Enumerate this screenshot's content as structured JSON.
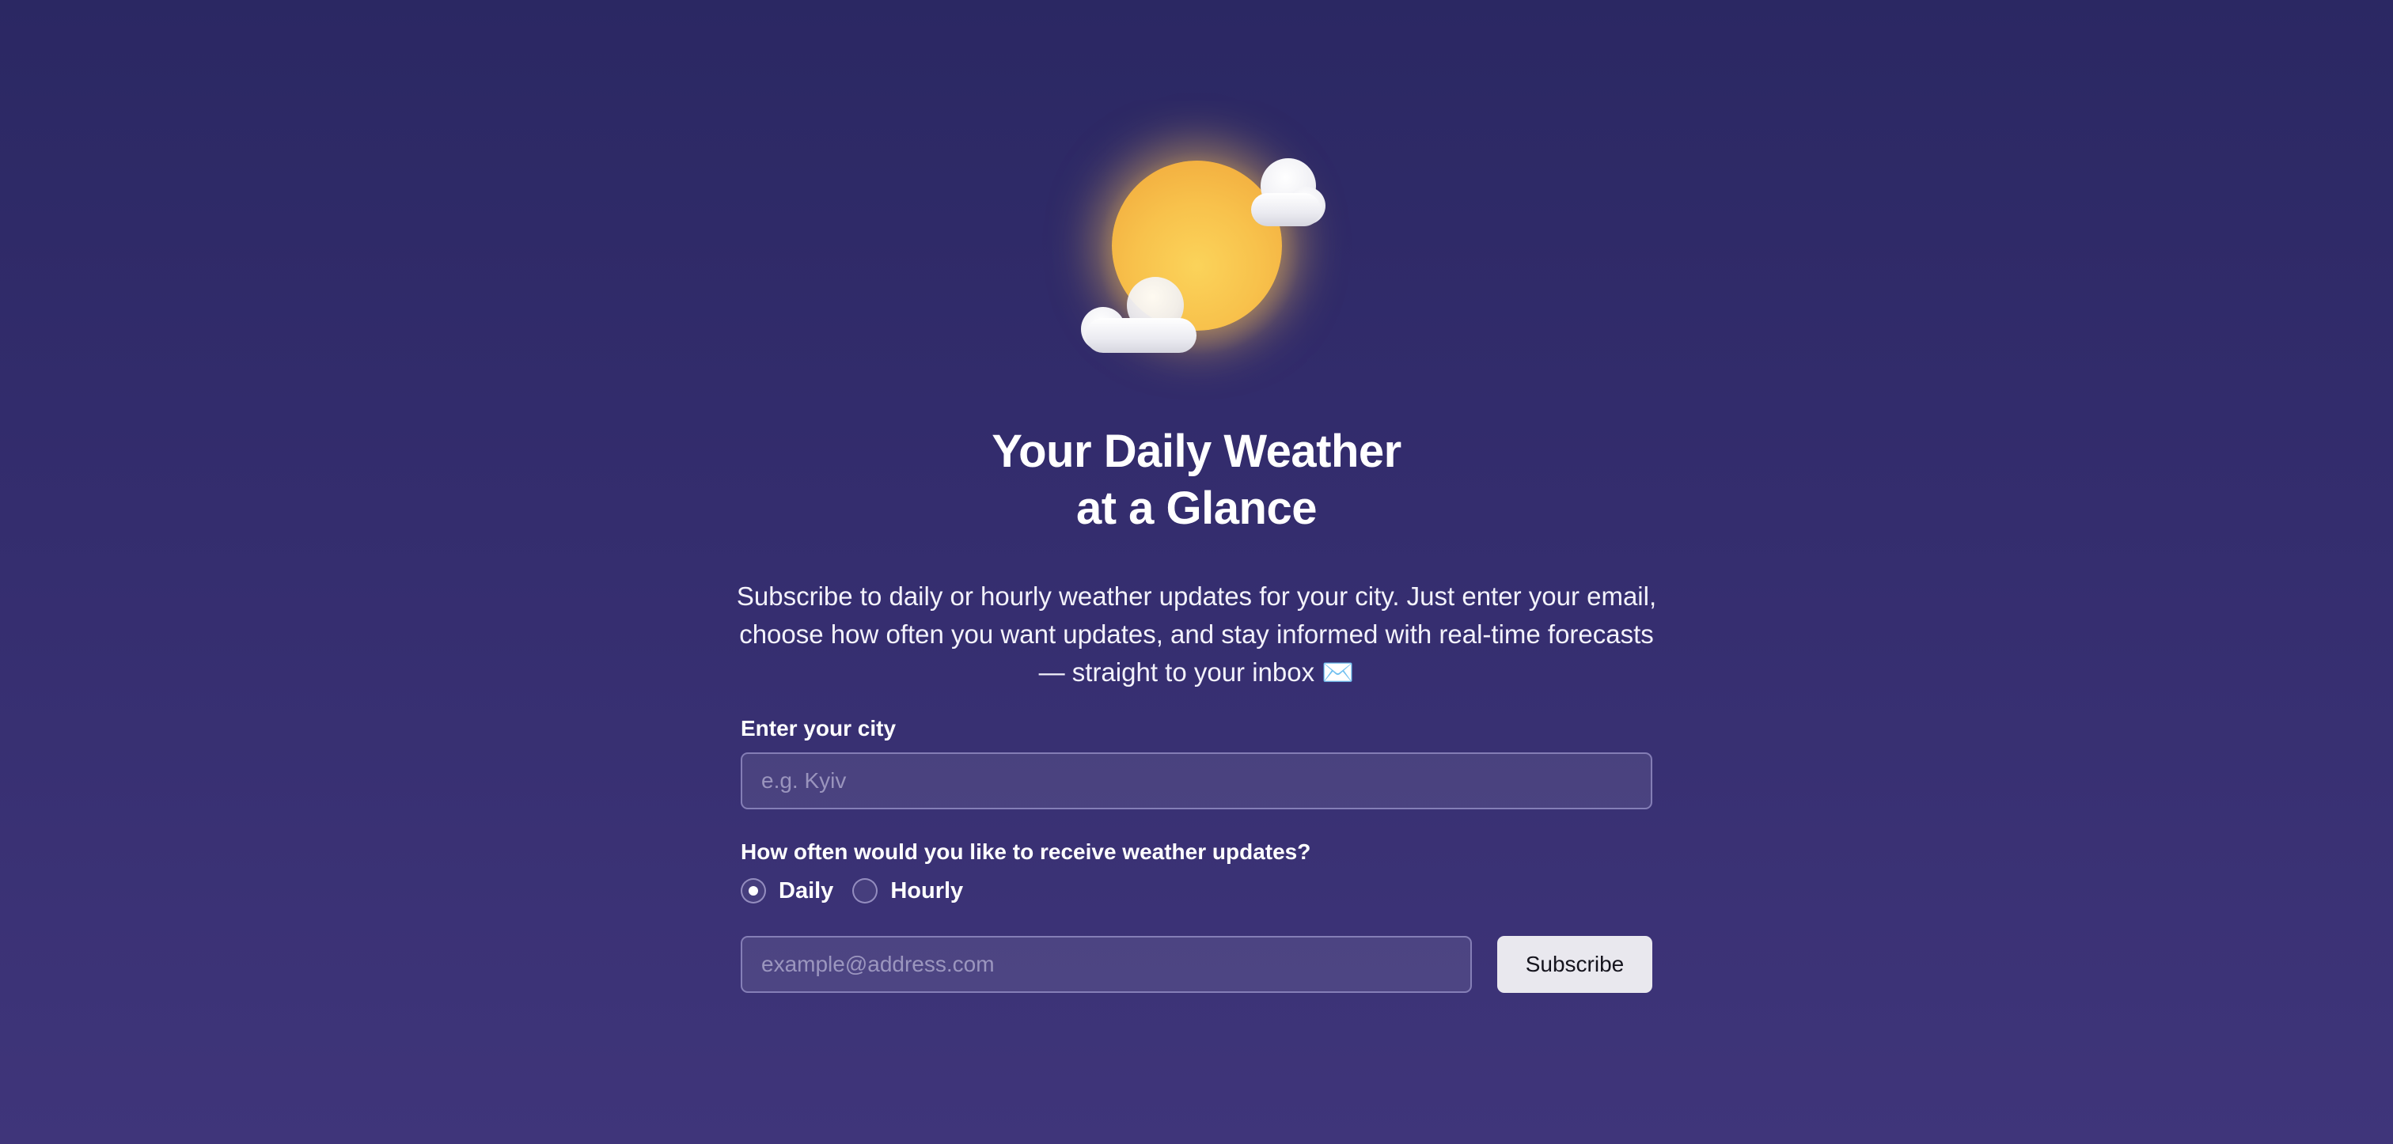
{
  "hero": {
    "title_line1": "Your Daily Weather",
    "title_line2": "at a Glance",
    "description": "Subscribe to daily or hourly weather updates for your city. Just enter your email, choose how often you want updates, and stay informed with real-time forecasts — straight to your inbox ✉️",
    "illustration_icon": "sun-behind-clouds-icon"
  },
  "form": {
    "city_label": "Enter your city",
    "city_placeholder": "e.g. Kyiv",
    "city_value": "",
    "frequency_label": "How often would you like to receive weather updates?",
    "frequency_options": [
      {
        "label": "Daily",
        "selected": true
      },
      {
        "label": "Hourly",
        "selected": false
      }
    ],
    "email_placeholder": "example@address.com",
    "email_value": "",
    "subscribe_label": "Subscribe"
  },
  "colors": {
    "background_top": "#2b2863",
    "background_bottom": "#3f357a",
    "sun": "#f8c24c",
    "button_bg": "#e9e8ee"
  }
}
